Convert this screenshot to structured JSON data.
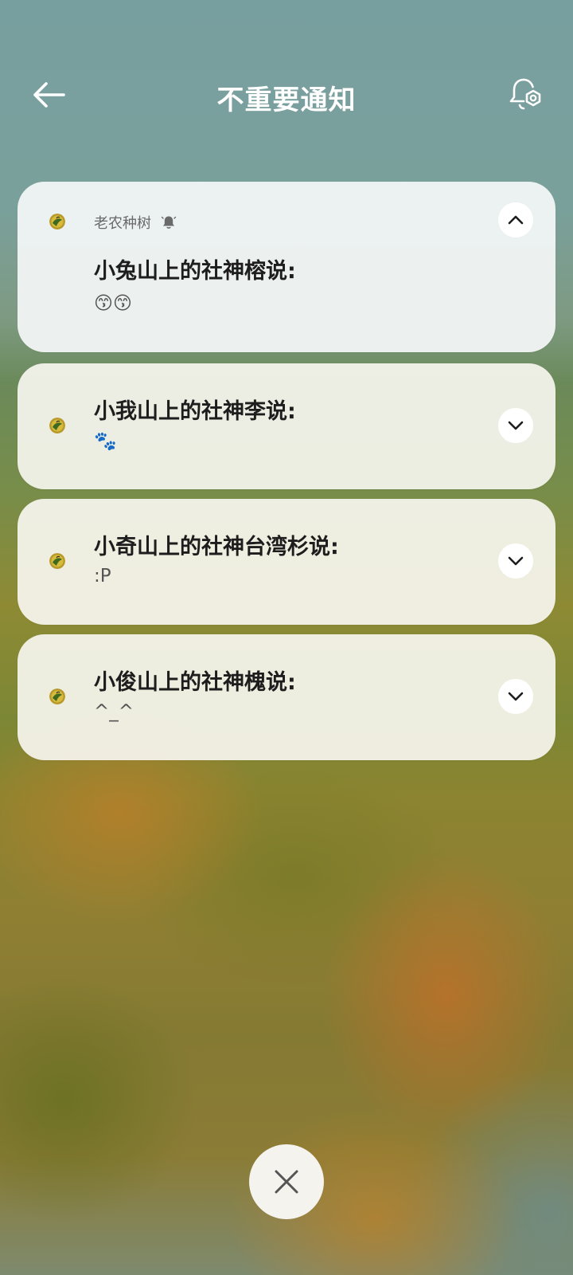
{
  "header": {
    "title": "不重要通知"
  },
  "notifications": [
    {
      "app_name": "老农种树",
      "title": "小兔山上的社神榕说:",
      "body": "😙😙",
      "expanded": true
    },
    {
      "title": "小我山上的社神李说:",
      "body": "🐾",
      "expanded": false
    },
    {
      "title": "小奇山上的社神台湾杉说:",
      "body": ":P",
      "expanded": false
    },
    {
      "title": "小俊山上的社神槐说:",
      "body": "^_^",
      "expanded": false
    }
  ],
  "icons": {
    "back": "arrow-left-icon",
    "settings": "bell-settings-icon",
    "app": "app-icon",
    "bell": "bell-icon",
    "collapse": "chevron-up-icon",
    "expand": "chevron-down-icon",
    "close": "close-icon"
  },
  "colors": {
    "card_background": "#f6f5ee",
    "title_text": "#ffffff",
    "message_title": "#1d1d1d"
  }
}
